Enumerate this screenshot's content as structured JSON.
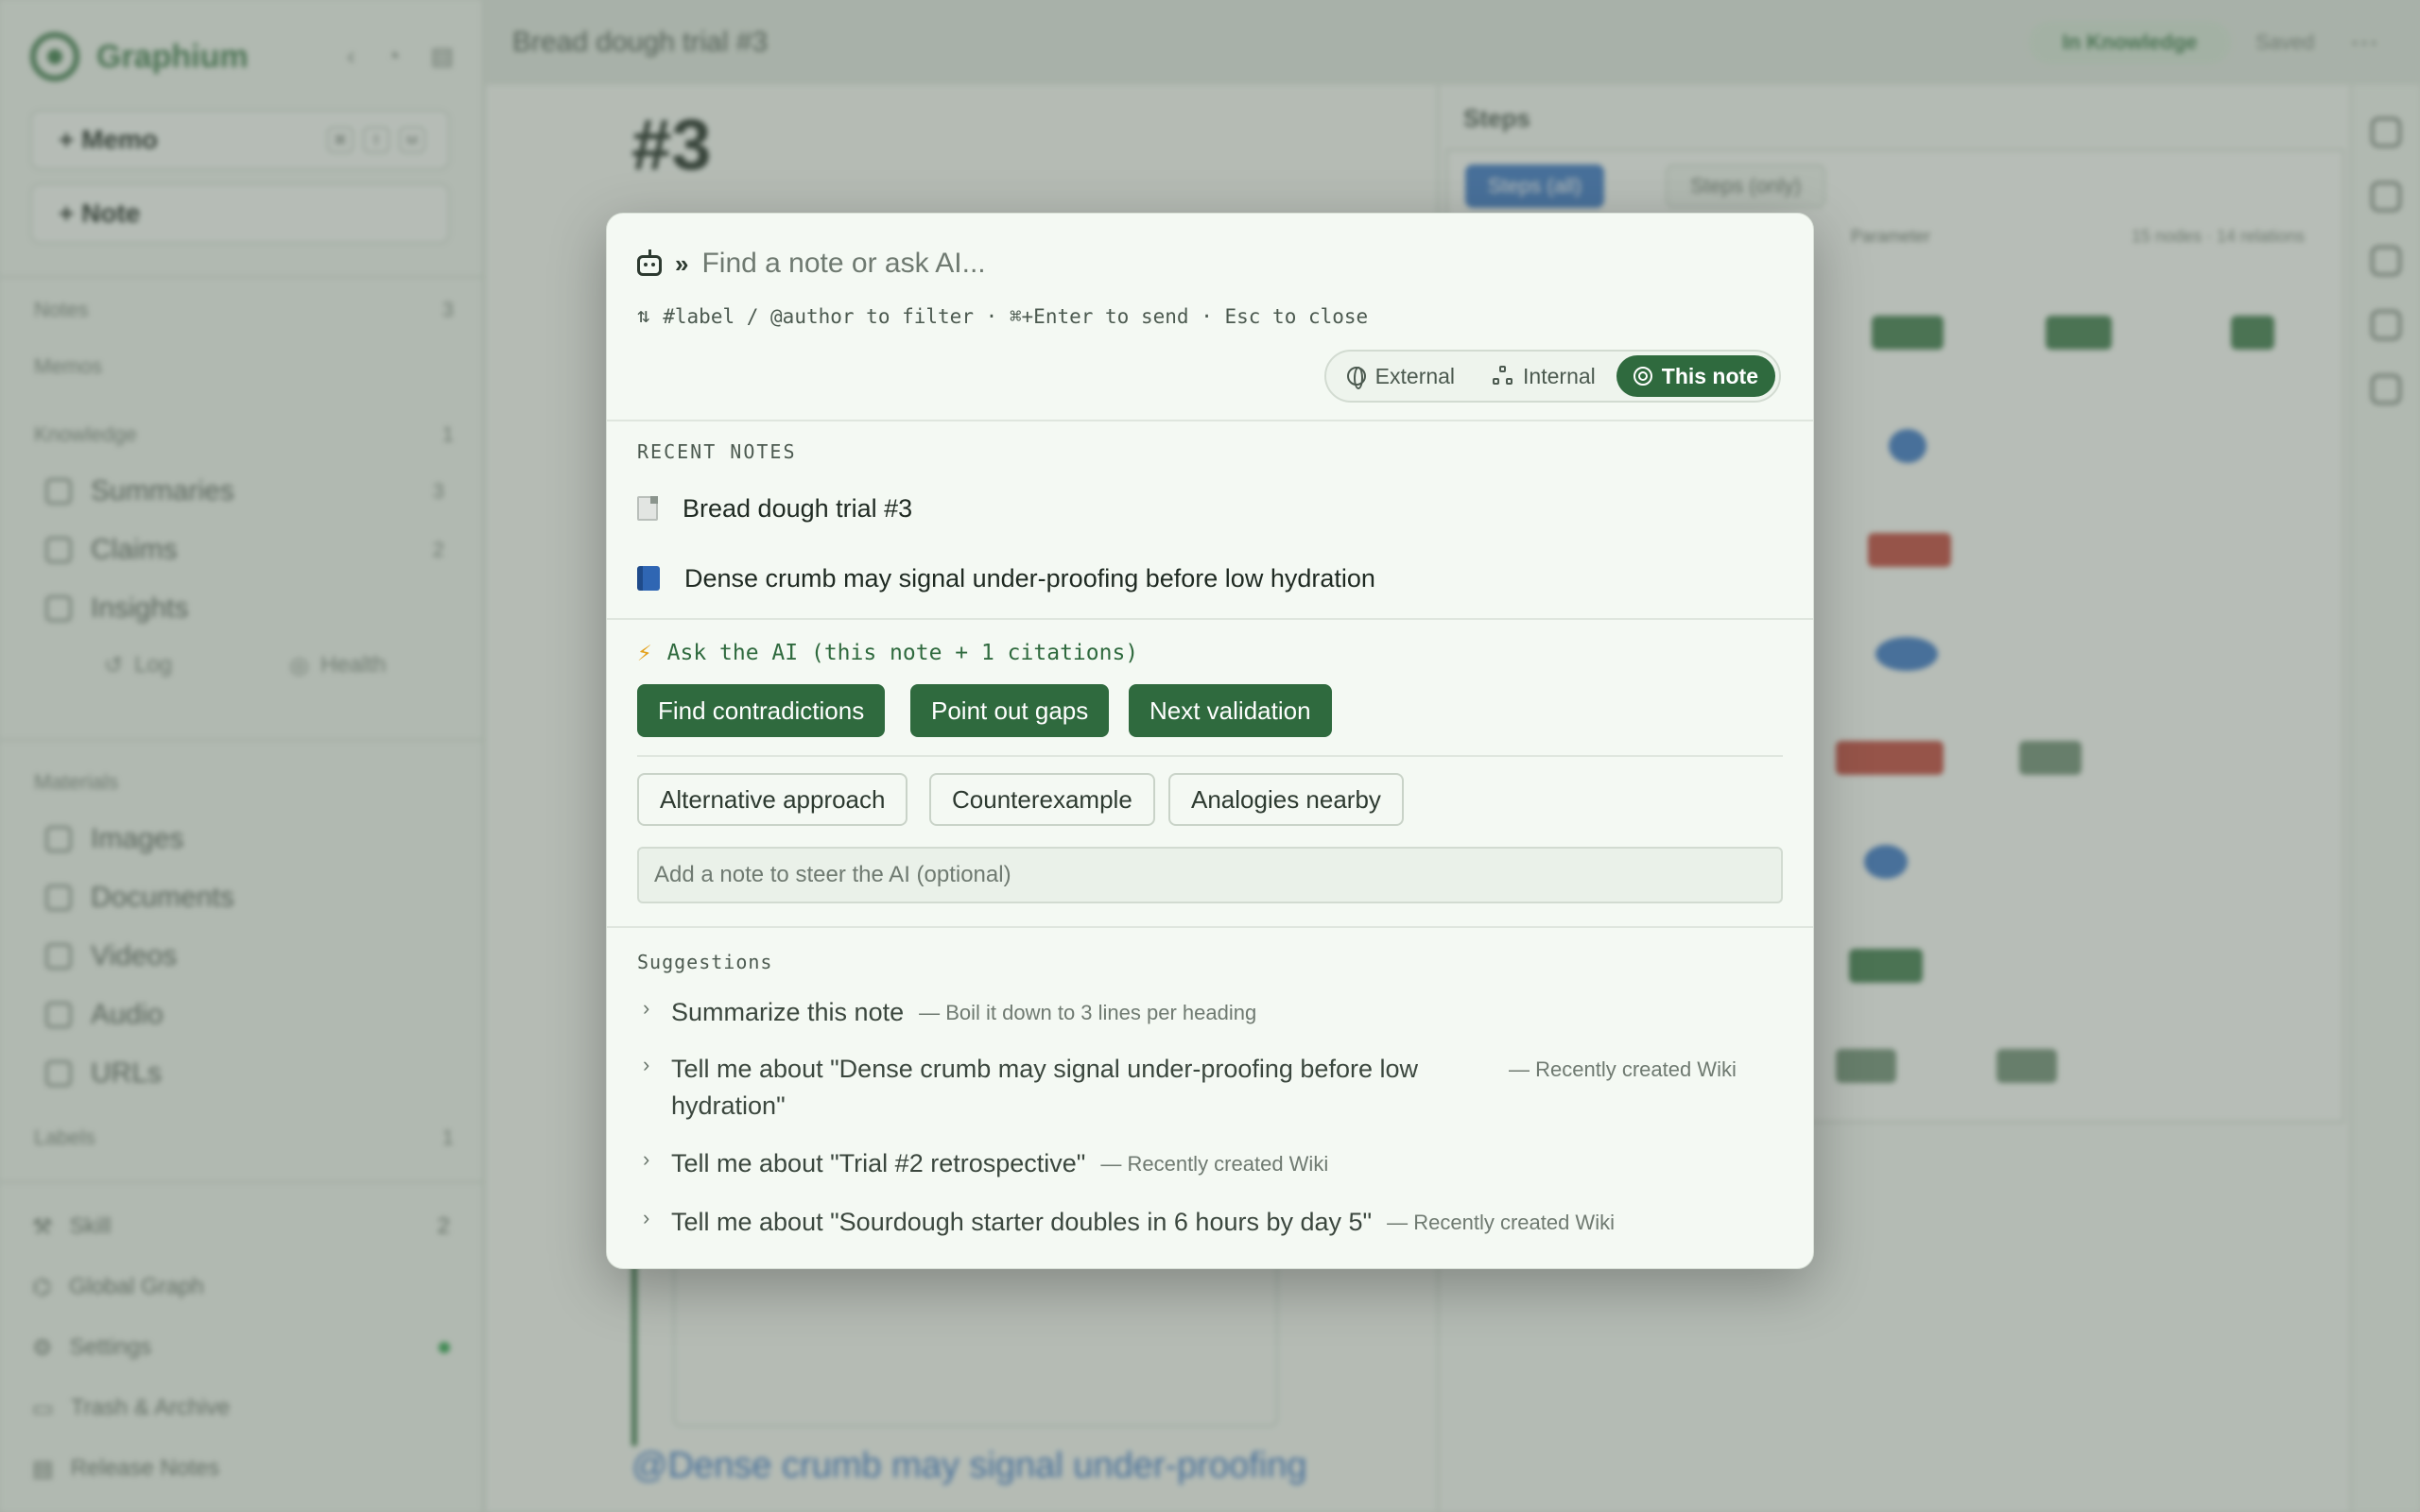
{
  "sidebar": {
    "brand": "Graphium",
    "quick_memo": "+ Memo",
    "quick_note": "+ Note",
    "sections": [
      {
        "label": "Notes",
        "count": "3"
      },
      {
        "label": "Memos",
        "count": ""
      },
      {
        "label": "Knowledge",
        "count": "1"
      }
    ],
    "knowledge_items": [
      {
        "label": "Summaries",
        "count": "3"
      },
      {
        "label": "Claims",
        "count": "2"
      },
      {
        "label": "Insights",
        "count": ""
      }
    ],
    "sub_log": "Log",
    "sub_health": "Health",
    "materials_label": "Materials",
    "materials_items": [
      "Images",
      "Documents",
      "Videos",
      "Audio",
      "URLs"
    ],
    "labels_label": "Labels",
    "labels_count": "1",
    "bottom_items": [
      {
        "label": "Skill",
        "count": "2"
      },
      {
        "label": "Global Graph",
        "count": ""
      },
      {
        "label": "Settings",
        "count": ""
      },
      {
        "label": "Trash & Archive",
        "count": ""
      },
      {
        "label": "Release Notes",
        "count": ""
      }
    ]
  },
  "header": {
    "doc_title": "Bread dough trial #3",
    "badge": "In Knowledge",
    "saved": "Saved",
    "more": "⋯"
  },
  "editor": {
    "heading": "#3",
    "link_text": "@Dense crumb may signal under-proofing"
  },
  "graph_panel": {
    "title": "Steps",
    "tab_all": "Steps (all)",
    "tab_only": "Steps (only)",
    "legend_param": "Parameter",
    "meta": "15 nodes · 14 relations"
  },
  "dialog": {
    "search_placeholder": "Find a note or ask AI...",
    "hint": "#label / @author to filter · ⌘+Enter to send · Esc to close",
    "scope": {
      "external": "External",
      "internal": "Internal",
      "this_note": "This note",
      "selected": "this_note"
    },
    "recent_label": "RECENT NOTES",
    "recent": [
      {
        "icon": "document-icon",
        "title": "Bread dough trial #3"
      },
      {
        "icon": "book-icon",
        "title": "Dense crumb may signal under-proofing before low hydration"
      }
    ],
    "ask_label": "Ask the AI (this note + 1 citations)",
    "primary_actions": [
      "Find contradictions",
      "Point out gaps",
      "Next validation"
    ],
    "secondary_actions": [
      "Alternative approach",
      "Counterexample",
      "Analogies nearby"
    ],
    "steer_placeholder": "Add a note to steer the AI (optional)",
    "suggestions_label": "Suggestions",
    "suggestions": [
      {
        "text": "Summarize this note",
        "sub": "— Boil it down to 3 lines per heading"
      },
      {
        "text": "Tell me about \"Dense crumb may signal under-proofing before low hydration\"",
        "sub": "— Recently created Wiki"
      },
      {
        "text": "Tell me about \"Trial #2 retrospective\"",
        "sub": "— Recently created Wiki"
      },
      {
        "text": "Tell me about \"Sourdough starter doubles in 6 hours by day 5\"",
        "sub": "— Recently created Wiki"
      }
    ]
  }
}
